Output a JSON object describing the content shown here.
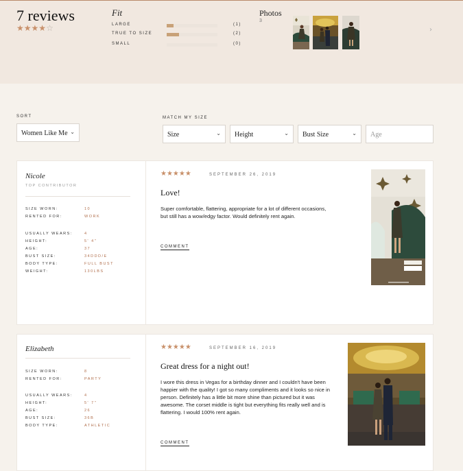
{
  "summary": {
    "title": "7 reviews",
    "rating": {
      "value": 4,
      "max": 5
    }
  },
  "fit": {
    "title": "Fit",
    "rows": [
      {
        "label": "LARGE",
        "count": "(1)",
        "fraction": 0.14
      },
      {
        "label": "TRUE TO SIZE",
        "count": "(2)",
        "fraction": 0.29
      },
      {
        "label": "SMALL",
        "count": "(0)",
        "fraction": 0.0
      }
    ]
  },
  "photos": {
    "title": "Photos",
    "count": "3"
  },
  "controls": {
    "sort_label": "SORT",
    "sort_value": "Women Like Me",
    "match_label": "MATCH MY SIZE",
    "size_value": "Size",
    "height_value": "Height",
    "bust_value": "Bust Size",
    "age_placeholder": "Age"
  },
  "reviews": [
    {
      "name": "Nicole",
      "badge": "TOP CONTRIBUTOR",
      "attrs": [
        {
          "k": "SIZE WORN:",
          "v": "10"
        },
        {
          "k": "RENTED FOR:",
          "v": "WORK"
        },
        {
          "k": "USUALLY WEARS:",
          "v": "4"
        },
        {
          "k": "HEIGHT:",
          "v": "5' 4\""
        },
        {
          "k": "AGE:",
          "v": "37"
        },
        {
          "k": "BUST SIZE:",
          "v": "34DDD/E"
        },
        {
          "k": "BODY TYPE:",
          "v": "FULL BUST"
        },
        {
          "k": "WEIGHT:",
          "v": "130LBS"
        }
      ],
      "stars": "★★★★★",
      "date": "SEPTEMBER 26, 2019",
      "title": "Love!",
      "body": "Super comfortable, flattering, appropriate for a lot of different occasions, but still has a wow/edgy factor. Would definitely rent again.",
      "comment": "COMMENT"
    },
    {
      "name": "Elizabeth",
      "attrs": [
        {
          "k": "SIZE WORN:",
          "v": "8"
        },
        {
          "k": "RENTED FOR:",
          "v": "PARTY"
        },
        {
          "k": "USUALLY WEARS:",
          "v": "4"
        },
        {
          "k": "HEIGHT:",
          "v": "5' 7\""
        },
        {
          "k": "AGE:",
          "v": "26"
        },
        {
          "k": "BUST SIZE:",
          "v": "36B"
        },
        {
          "k": "BODY TYPE:",
          "v": "ATHLETIC"
        }
      ],
      "stars": "★★★★★",
      "date": "SEPTEMBER 16, 2019",
      "title": "Great dress for a night out!",
      "body": "I wore this dress in Vegas for a birthday dinner and I couldn't have been happier with the quality! I got so many compliments and it looks so nice in person. Definitely has a little bit more shine than pictured but it was awesome. The corset middle is tight but everything fits really well and is flattering. I would 100% rent again.",
      "comment": "COMMENT"
    }
  ],
  "colors": {
    "accent": "#c8906a",
    "attr_value": "#b06e4b",
    "hero_bg": "#f1e8e0",
    "page_bg": "#f6f2ec"
  }
}
